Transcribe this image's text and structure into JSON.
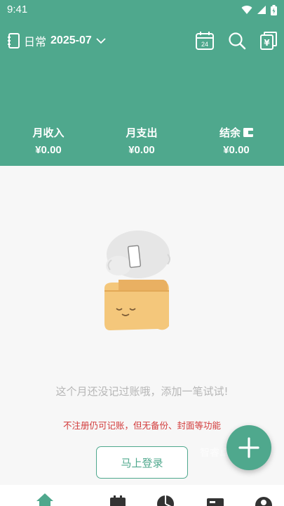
{
  "status_bar": {
    "time": "9:41"
  },
  "toolbar": {
    "book_name": "日常",
    "period": "2025-07",
    "calendar_day": "24",
    "bills_symbol": "¥"
  },
  "summary": {
    "income": {
      "label": "月收入",
      "value": "¥0.00"
    },
    "expense": {
      "label": "月支出",
      "value": "¥0.00"
    },
    "balance": {
      "label": "结余",
      "value": "¥0.00"
    }
  },
  "empty_state": {
    "message": "这个月还没记过账哦，添加一笔试试!",
    "notice": "不注册仍可记账，但无备份、封面等功能",
    "login_button": "马上登录"
  },
  "watermark": "智睿卓网",
  "colors": {
    "accent": "#4fa88d",
    "warning": "#d23a3a",
    "muted_text": "#b6b6b6"
  },
  "tabs": [
    {
      "name": "home",
      "icon": "home-icon",
      "active": true
    },
    {
      "name": "calendar",
      "icon": "calendar-icon",
      "active": false
    },
    {
      "name": "statistics",
      "icon": "pie-chart-icon",
      "active": false
    },
    {
      "name": "assets",
      "icon": "card-icon",
      "active": false
    },
    {
      "name": "profile",
      "icon": "user-icon",
      "active": false
    }
  ]
}
